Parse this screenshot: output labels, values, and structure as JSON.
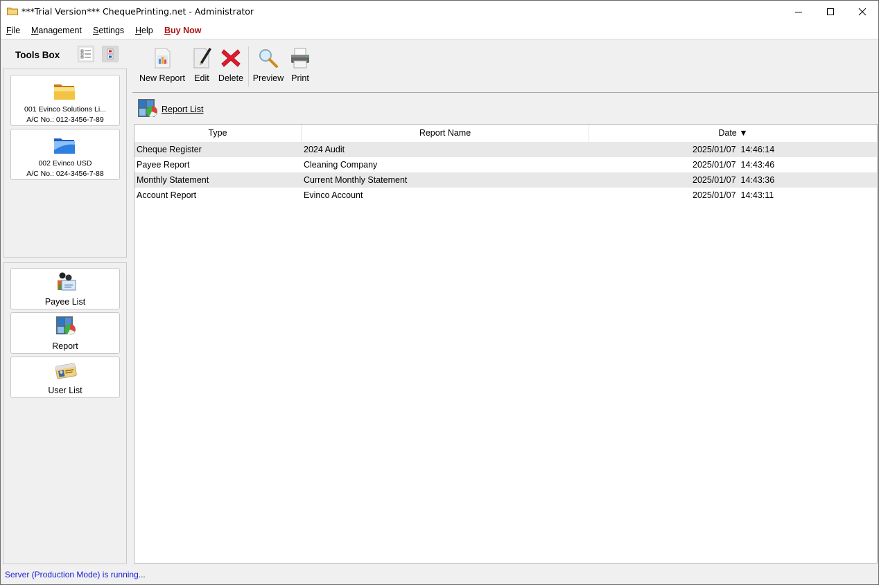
{
  "window": {
    "title": "***Trial Version*** ChequePrinting.net - Administrator",
    "controls": {
      "minimize": "minimize",
      "maximize": "maximize",
      "close": "close"
    }
  },
  "menubar": {
    "items": [
      {
        "label_u": "F",
        "label_rest": "ile"
      },
      {
        "label_u": "M",
        "label_rest": "anagement"
      },
      {
        "label_u": "S",
        "label_rest": "ettings"
      },
      {
        "label_u": "H",
        "label_rest": "elp"
      },
      {
        "label_u": "B",
        "label_rest": "uy Now",
        "accent": "#b01010"
      }
    ]
  },
  "toolsbox": {
    "title": "Tools Box",
    "view_buttons": [
      "list-view",
      "tile-view"
    ],
    "accounts": [
      {
        "name": "001 Evinco Solutions Li...",
        "acno": "A/C No.: 012-3456-7-89",
        "icon": "folder-yellow-icon"
      },
      {
        "name": "002 Evinco USD",
        "acno": "A/C No.: 024-3456-7-88",
        "icon": "folder-blue-icon"
      }
    ],
    "tools": [
      {
        "label": "Payee List",
        "icon": "payee-list-icon"
      },
      {
        "label": "Report",
        "icon": "report-icon"
      },
      {
        "label": "User List",
        "icon": "user-list-icon"
      }
    ]
  },
  "toolbar": {
    "new_report": "New Report",
    "edit": "Edit",
    "delete": "Delete",
    "preview": "Preview",
    "print": "Print"
  },
  "report_list": {
    "link": "Report List",
    "columns": [
      "Type",
      "Report Name",
      "Date"
    ],
    "sort": {
      "column": "Date",
      "direction": "descending",
      "glyph": "▼"
    },
    "rows": [
      {
        "type": "Cheque Register",
        "name": "2024 Audit",
        "date": "2025/01/07  14:46:14"
      },
      {
        "type": "Payee Report",
        "name": "Cleaning Company",
        "date": "2025/01/07  14:43:46"
      },
      {
        "type": "Monthly Statement",
        "name": "Current Monthly Statement",
        "date": "2025/01/07  14:43:36"
      },
      {
        "type": "Account Report",
        "name": "Evinco Account",
        "date": "2025/01/07  14:43:11"
      }
    ]
  },
  "status_bar": {
    "text": "Server (Production Mode) is running...",
    "color": "#1a1ad8"
  }
}
